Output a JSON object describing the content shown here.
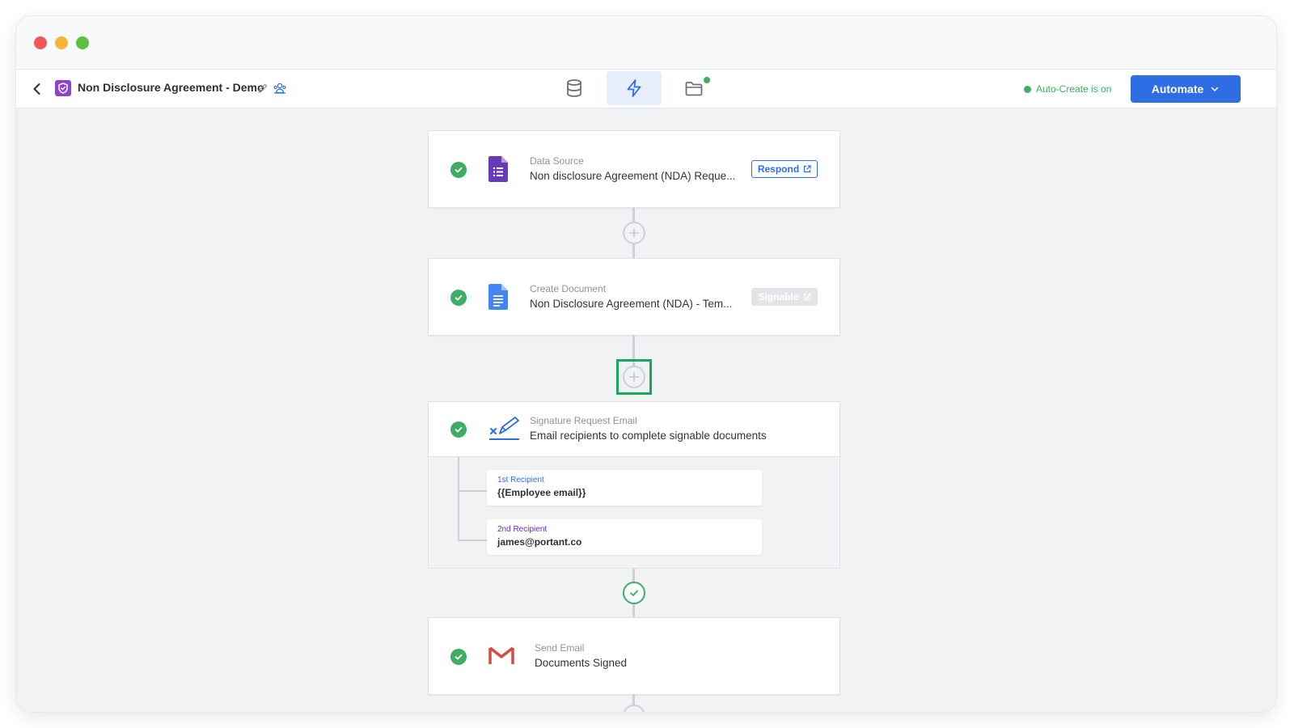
{
  "header": {
    "title": "Non Disclosure Agreement - Demo",
    "status_text": "Auto-Create is on",
    "automate_label": "Automate"
  },
  "tabs": [
    {
      "icon": "database-icon"
    },
    {
      "icon": "lightning-icon",
      "active": true
    },
    {
      "icon": "folder-icon",
      "notification": true
    }
  ],
  "steps": [
    {
      "label": "Data Source",
      "name": "Non disclosure Agreement (NDA) Reque...",
      "action": "Respond",
      "icon": "google-forms-icon"
    },
    {
      "label": "Create Document",
      "name": "Non Disclosure Agreement (NDA) - Tem...",
      "action": "Signable",
      "action_disabled": true,
      "icon": "google-docs-icon"
    },
    {
      "label": "Signature Request Email",
      "name": "Email recipients to complete signable documents",
      "icon": "signature-icon"
    },
    {
      "label": "Send Email",
      "name": "Documents Signed",
      "icon": "gmail-icon"
    }
  ],
  "recipients": [
    {
      "label": "1st Recipient",
      "value": "{{Employee email}}"
    },
    {
      "label": "2nd Recipient",
      "value": "james@portant.co"
    }
  ],
  "colors": {
    "accent": "#2f6de4",
    "success": "#3fae63",
    "highlight": "#18a85a",
    "recipient_1_label": "#2f6de4",
    "recipient_2_label": "#5b2bd6"
  }
}
